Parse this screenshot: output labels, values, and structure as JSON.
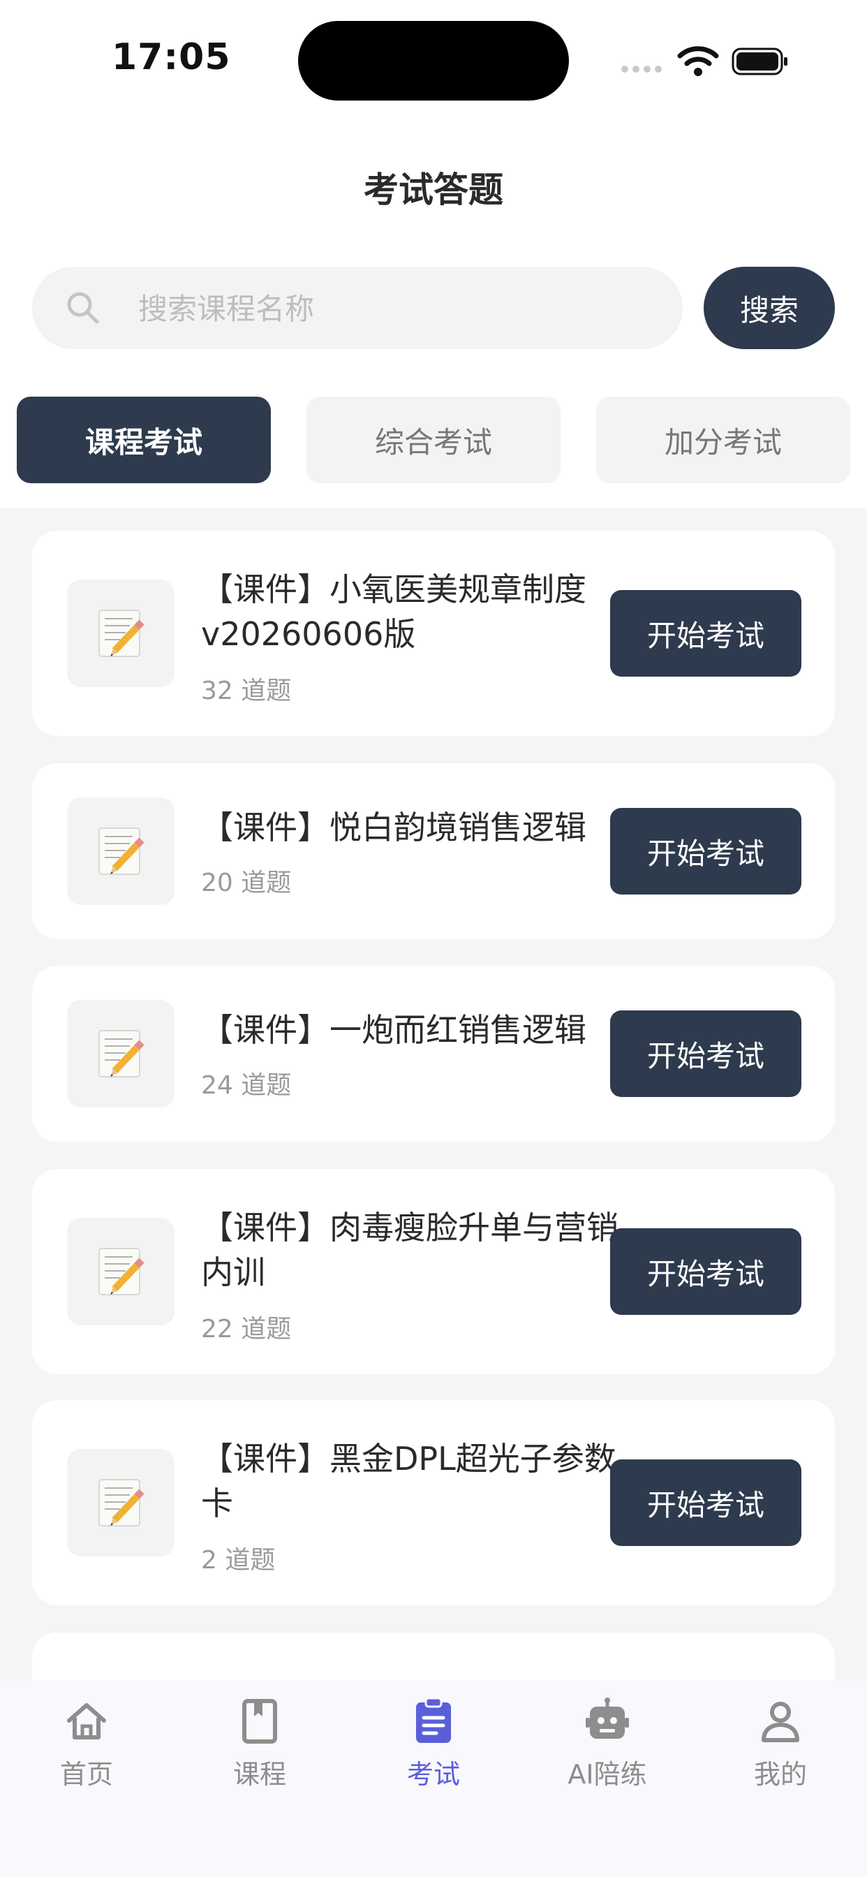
{
  "status_bar": {
    "time": "17:05"
  },
  "header": {
    "title": "考试答题"
  },
  "search": {
    "placeholder": "搜索课程名称",
    "button_label": "搜索"
  },
  "tabs": [
    {
      "label": "课程考试",
      "active": true
    },
    {
      "label": "综合考试",
      "active": false
    },
    {
      "label": "加分考试",
      "active": false
    }
  ],
  "courses": [
    {
      "title": "【课件】小氧医美规章制度v20260606版",
      "count": "32 道题",
      "button": "开始考试",
      "icon": "memo-icon"
    },
    {
      "title": "【课件】悦白韵境销售逻辑",
      "count": "20 道题",
      "button": "开始考试",
      "icon": "memo-icon"
    },
    {
      "title": "【课件】一炮而红销售逻辑",
      "count": "24 道题",
      "button": "开始考试",
      "icon": "memo-icon"
    },
    {
      "title": "【课件】肉毒瘦脸升单与营销内训",
      "count": "22 道题",
      "button": "开始考试",
      "icon": "memo-icon"
    },
    {
      "title": "【课件】黑金DPL超光子参数卡",
      "count": "2 道题",
      "button": "开始考试",
      "icon": "memo-icon"
    }
  ],
  "bottom_nav": [
    {
      "label": "首页",
      "icon": "home-icon",
      "active": false
    },
    {
      "label": "课程",
      "icon": "book-icon",
      "active": false
    },
    {
      "label": "考试",
      "icon": "clipboard-icon",
      "active": true
    },
    {
      "label": "AI陪练",
      "icon": "robot-icon",
      "active": false
    },
    {
      "label": "我的",
      "icon": "user-icon",
      "active": false
    }
  ],
  "colors": {
    "primary": "#2e3a4d",
    "accent": "#5a5fd9",
    "background": "#f5f5f7"
  }
}
